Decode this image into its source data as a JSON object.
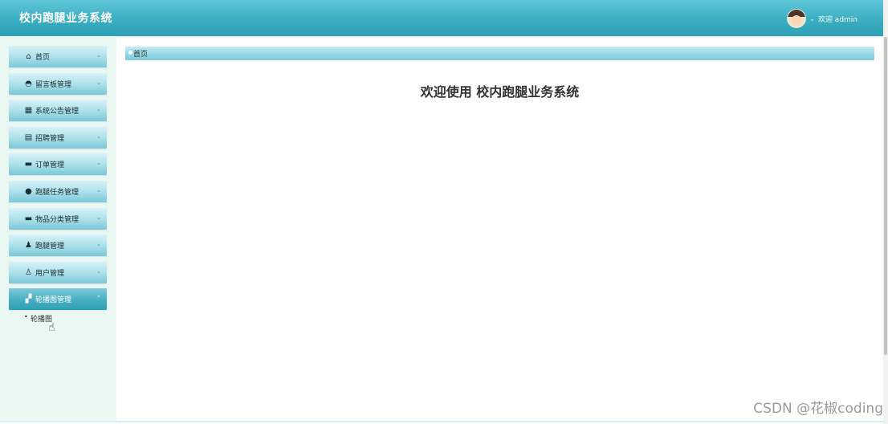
{
  "header": {
    "title": "校内跑腿业务系统",
    "user": {
      "name": "欢迎 admin",
      "chevron": "⌄"
    }
  },
  "sidebar": {
    "items": [
      {
        "label": "首页",
        "icon": "home-icon",
        "glyph": "⌂"
      },
      {
        "label": "留言板管理",
        "icon": "message-icon",
        "glyph": "◓"
      },
      {
        "label": "系统公告管理",
        "icon": "grid-icon",
        "glyph": "▦"
      },
      {
        "label": "招聘管理",
        "icon": "building-icon",
        "glyph": "▤"
      },
      {
        "label": "订单管理",
        "icon": "order-icon",
        "glyph": "▬"
      },
      {
        "label": "跑腿任务管理",
        "icon": "drop-icon",
        "glyph": "●"
      },
      {
        "label": "物品分类管理",
        "icon": "box-icon",
        "glyph": "▬"
      },
      {
        "label": "跑腿管理",
        "icon": "user-icon",
        "glyph": "♟"
      },
      {
        "label": "用户管理",
        "icon": "user-outline-icon",
        "glyph": "♙"
      },
      {
        "label": "轮播图管理",
        "icon": "image-icon",
        "glyph": "▞"
      }
    ],
    "chevron_down": "⌄",
    "chevron_up": "⌃",
    "submenu": [
      {
        "label": "轮播图",
        "bullet": "•"
      }
    ]
  },
  "main": {
    "breadcrumb": "首页",
    "welcome": "欢迎使用 校内跑腿业务系统"
  },
  "watermark": "CSDN @花椒coding"
}
